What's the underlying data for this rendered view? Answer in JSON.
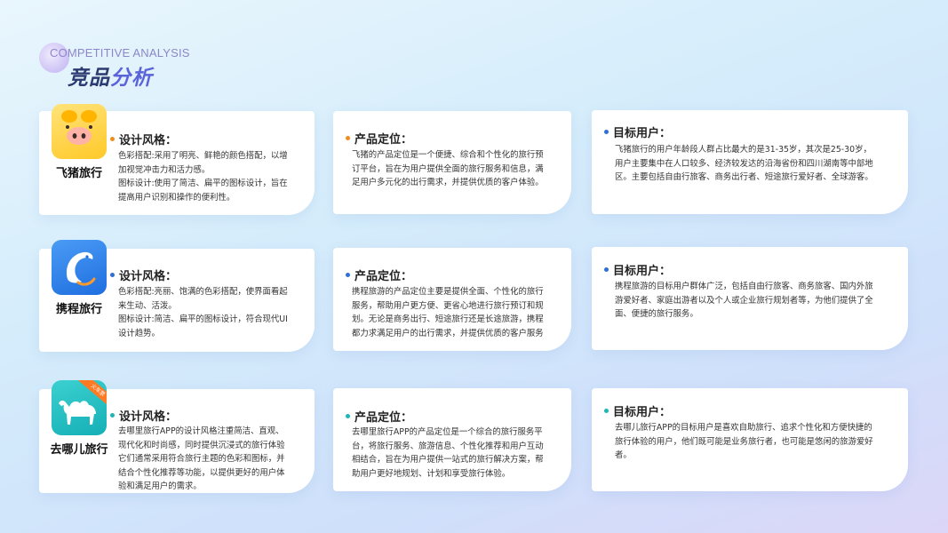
{
  "header": {
    "subtitle_en": "COMPETITIVE ANALYSIS",
    "title_part1": "竞品",
    "title_part2": "分析"
  },
  "colors": {
    "orange": "#f08c1e",
    "blue": "#2f6fd6",
    "teal": "#20b5b5"
  },
  "apps": [
    {
      "name": "飞猪旅行",
      "icon": "pig-logo-icon",
      "design": {
        "title": "设计风格：",
        "lines": [
          "色彩搭配:采用了明亮、鲜艳的颜色搭配，以增",
          "加视觉冲击力和活力感。",
          "图标设计:使用了简洁、扁平的图标设计，旨在",
          "提高用户识别和操作的便利性。"
        ]
      },
      "positioning": {
        "title": "产品定位：",
        "lines": [
          "飞猪的产品定位是一个便捷、综合和个性化的旅行预",
          "订平台，旨在为用户提供全面的旅行服务和信息，满",
          "足用户多元化的出行需求，并提供优质的客户体验。"
        ]
      },
      "users": {
        "title": "目标用户：",
        "lines": [
          "飞猪旅行的用户年龄段人群占比最大的是31-35岁，其次是25-30岁，",
          "用户主要集中在人口较多、经济较发达的沿海省份和四川湖南等中部地",
          "区。主要包括自由行旅客、商务出行者、短途旅行爱好者、全球游客。"
        ]
      }
    },
    {
      "name": "携程旅行",
      "icon": "dolphin-logo-icon",
      "design": {
        "title": "设计风格：",
        "lines": [
          "色彩搭配:亮丽、饱满的色彩搭配，使界面看起",
          "来生动、活泼。",
          "图标设计:简洁、扁平的图标设计，符合现代UI",
          "设计趋势。"
        ]
      },
      "positioning": {
        "title": "产品定位：",
        "lines": [
          "携程旅游的产品定位主要是提供全面、个性化的旅行",
          "服务，帮助用户更方便、更省心地进行旅行预订和规",
          "划。无论是商务出行、短途旅行还是长途旅游，携程",
          "都力求满足用户的出行需求，并提供优质的客户服务"
        ]
      },
      "users": {
        "title": "目标用户：",
        "lines": [
          "携程旅游的目标用户群体广泛，包括自由行旅客、商务旅客、国内外旅",
          "游爱好者、家庭出游者以及个人或企业旅行规划者等，为他们提供了全",
          "面、便捷的旅行服务。"
        ]
      }
    },
    {
      "name": "去哪儿旅行",
      "icon": "camel-logo-icon",
      "badge": "火车票",
      "design": {
        "title": "设计风格：",
        "lines": [
          "去哪里旅行APP的设计风格注重简洁、直观、",
          "现代化和时尚感，同时提供沉浸式的旅行体验",
          "它们通常采用符合旅行主题的色彩和图标，并",
          "结合个性化推荐等功能，以提供更好的用户体",
          "验和满足用户的需求。"
        ]
      },
      "positioning": {
        "title": "产品定位：",
        "lines": [
          "去哪里旅行APP的产品定位是一个综合的旅行服务平",
          "台，将旅行服务、旅游信息、个性化推荐和用户互动",
          "相结合，旨在为用户提供一站式的旅行解决方案，帮",
          "助用户更好地规划、计划和享受旅行体验。"
        ]
      },
      "users": {
        "title": "目标用户：",
        "lines": [
          "去哪儿旅行APP的目标用户是喜欢自助旅行、追求个性化和方便快捷的",
          "旅行体验的用户，他们既可能是业务旅行者，也可能是悠闲的旅游爱好",
          "者。"
        ]
      }
    }
  ]
}
